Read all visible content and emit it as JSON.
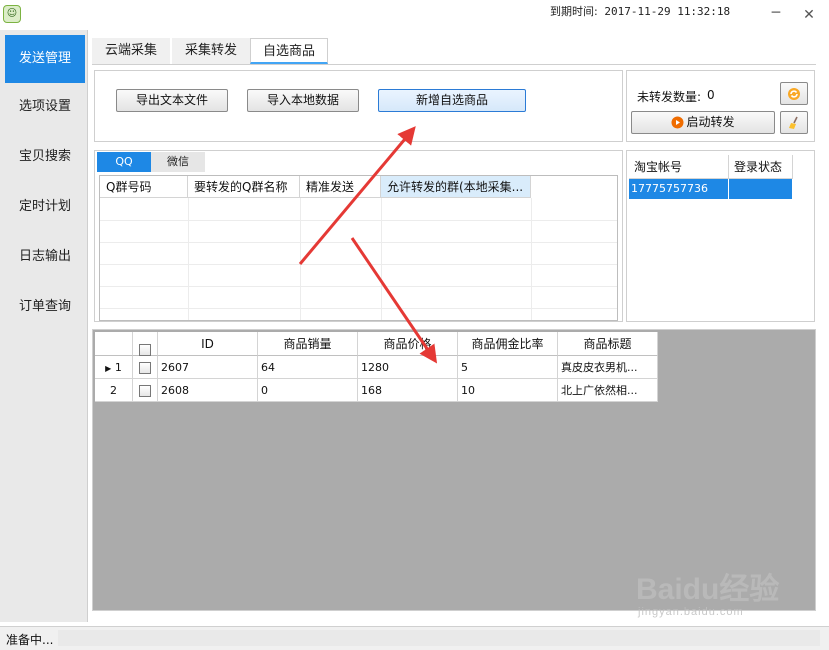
{
  "window": {
    "expire_label": "到期时间:",
    "expire_time": "2017-11-29 11:32:18",
    "minimize_glyph": "─",
    "close_glyph": "✕"
  },
  "sidebar": {
    "items": [
      {
        "label": "发送管理",
        "active": true
      },
      {
        "label": "选项设置",
        "active": false
      },
      {
        "label": "宝贝搜索",
        "active": false
      },
      {
        "label": "定时计划",
        "active": false
      },
      {
        "label": "日志输出",
        "active": false
      },
      {
        "label": "订单查询",
        "active": false
      }
    ]
  },
  "tabs": [
    {
      "label": "云端采集",
      "active": false
    },
    {
      "label": "采集转发",
      "active": false
    },
    {
      "label": "自选商品",
      "active": true
    }
  ],
  "actions": {
    "export_text": "导出文本文件",
    "import_local": "导入本地数据",
    "add_custom": "新增自选商品"
  },
  "forward": {
    "pending_label": "未转发数量:",
    "pending_count": "0",
    "start_label": "启动转发"
  },
  "group_panel": {
    "subtabs": [
      {
        "label": "QQ",
        "active": true
      },
      {
        "label": "微信",
        "active": false
      }
    ],
    "columns": [
      "Q群号码",
      "要转发的Q群名称",
      "精准发送",
      "允许转发的群(本地采集..."
    ]
  },
  "accounts": {
    "columns": [
      "淘宝帐号",
      "登录状态"
    ],
    "rows": [
      {
        "account": "17775757736",
        "status": ""
      }
    ]
  },
  "products": {
    "columns": [
      "ID",
      "商品销量",
      "商品价格",
      "商品佣金比率",
      "商品标题"
    ],
    "rows": [
      {
        "row": "1",
        "id": "2607",
        "sales": "64",
        "price": "1280",
        "commission": "5",
        "title": "真皮皮衣男机..."
      },
      {
        "row": "2",
        "id": "2608",
        "sales": "0",
        "price": "168",
        "commission": "10",
        "title": "北上广依然相..."
      }
    ]
  },
  "status": {
    "text": "准备中..."
  },
  "watermark": {
    "brand": "Baidu经验",
    "url": "jingyan.baidu.com"
  },
  "colors": {
    "accent": "#1e88e5",
    "arrow": "#e53935"
  }
}
